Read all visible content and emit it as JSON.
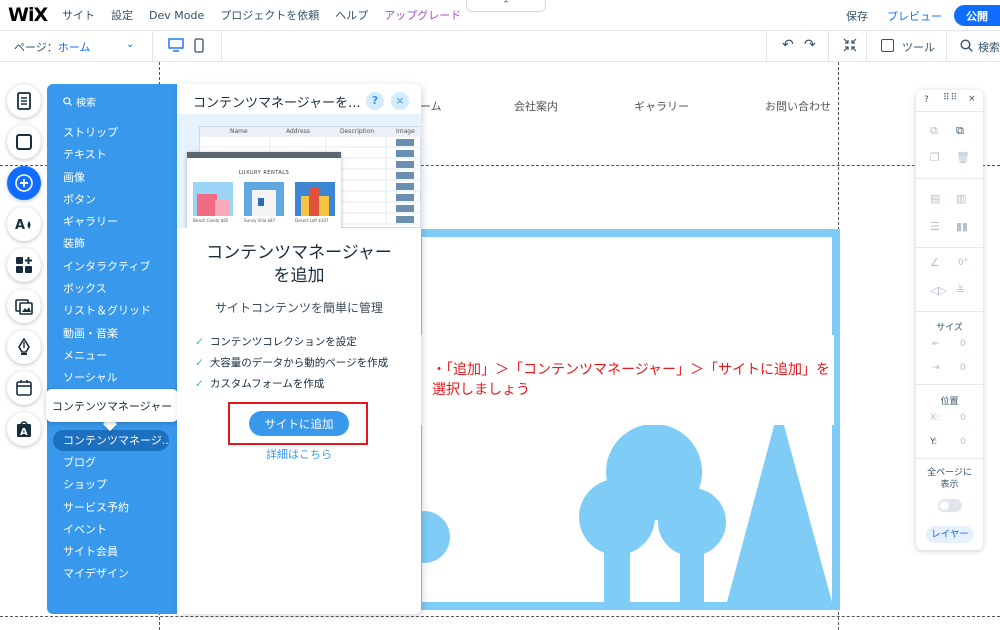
{
  "topbar": {
    "logo": "WiX",
    "menu": [
      "サイト",
      "設定",
      "Dev Mode",
      "プロジェクトを依頼",
      "ヘルプ"
    ],
    "upgrade": "アップグレード",
    "collapse": "⌃",
    "save": "保存",
    "preview": "プレビュー",
    "publish": "公開"
  },
  "secondbar": {
    "page_label": "ページ：",
    "page_value": "ホーム",
    "tools": "ツール",
    "search": "検索"
  },
  "site": {
    "nav": [
      "ーム",
      "会社案内",
      "ギャラリー",
      "お問い合わせ"
    ]
  },
  "annotation": {
    "text": "・「追加」＞「コンテンツマネージャー」＞「サイトに追加」を選択しましょう"
  },
  "add_panel": {
    "search": "検索",
    "categories": [
      "ストリップ",
      "テキスト",
      "画像",
      "ボタン",
      "ギャラリー",
      "装飾",
      "インタラクティブ",
      "ボックス",
      "リスト＆グリッド",
      "動画・音楽",
      "メニュー",
      "ソーシャル"
    ],
    "selected": "コンテンツマネージ...",
    "categories_after": [
      "ブログ",
      "ショップ",
      "サービス予約",
      "イベント",
      "サイト会員",
      "マイデザイン"
    ],
    "tooltip": "コンテンツマネージャー"
  },
  "detail": {
    "title": "コンテンツマネージャーを...",
    "help": "?",
    "close": "×",
    "illustration": {
      "columns": [
        "Name",
        "Address",
        "Description",
        "Image"
      ],
      "window_title": "LUXURY RENTALS",
      "cards": [
        "Beach Condo  $85",
        "Sunny Villa  $87",
        "Desert Loft  $107"
      ]
    },
    "feature_title_line1": "コンテンツマネージャー",
    "feature_title_line2": "を追加",
    "feature_subtitle": "サイトコンテンツを簡単に管理",
    "features": [
      "コンテンツコレクションを設定",
      "大容量のデータから動的ページを作成",
      "カスタムフォームを作成"
    ],
    "check": "✓",
    "add_button": "サイトに追加",
    "learn_more": "詳細はこちら"
  },
  "right_panel": {
    "help": "?",
    "close": "×",
    "rotation": "0°",
    "size_label": "サイズ",
    "w_value": "0",
    "h_value": "0",
    "position_label": "位置",
    "x_label": "X:",
    "x_value": "0",
    "y_label": "Y:",
    "y_value": "0",
    "all_pages": "全ページに表示",
    "layers": "レイヤー"
  },
  "colors": {
    "accent": "#116dff",
    "panel_blue": "#3899ec",
    "annotation_red": "#e8161b",
    "placeholder_blue": "#7fccf7"
  }
}
